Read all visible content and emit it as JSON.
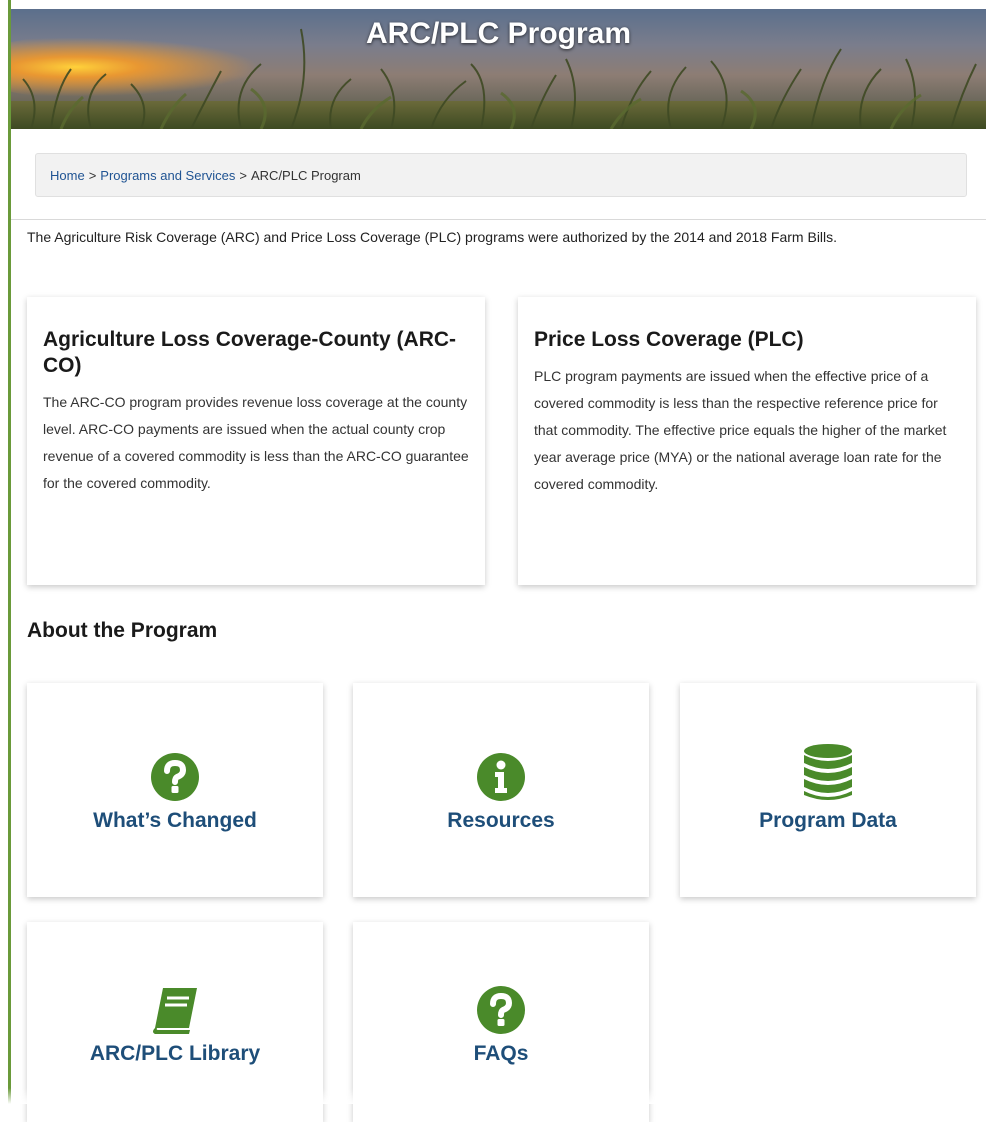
{
  "banner": {
    "title": "ARC/PLC Program"
  },
  "breadcrumb": {
    "home": "Home",
    "programs": "Programs and Services",
    "current": "ARC/PLC Program",
    "separator": ">"
  },
  "intro": "The Agriculture Risk Coverage (ARC) and Price Loss Coverage (PLC) programs were authorized by the 2014 and 2018 Farm Bills.",
  "cards": {
    "arc": {
      "title": "Agriculture Loss Coverage-County (ARC-CO)",
      "body": "The ARC-CO program provides revenue loss coverage at the county level. ARC-CO payments are issued when the actual county crop revenue of a covered commodity is less than the ARC-CO guarantee for the covered commodity."
    },
    "plc": {
      "title": "Price Loss Coverage (PLC)",
      "body": "PLC program payments are issued when the effective price of a covered commodity is less than the respective reference price for that commodity. The effective price equals the higher of the market year average price (MYA) or the national average loan rate for the covered commodity."
    }
  },
  "about": {
    "heading": "About the Program",
    "tiles": [
      {
        "label": "What’s Changed",
        "icon": "question-circle-icon"
      },
      {
        "label": "Resources",
        "icon": "info-circle-icon"
      },
      {
        "label": "Program Data",
        "icon": "database-icon"
      },
      {
        "label": "ARC/PLC Library",
        "icon": "book-icon"
      },
      {
        "label": "FAQs",
        "icon": "question-circle-icon"
      }
    ]
  },
  "colors": {
    "icon_green": "#4a8a2a",
    "link_blue": "#205493",
    "tile_label": "#1e4e79"
  }
}
